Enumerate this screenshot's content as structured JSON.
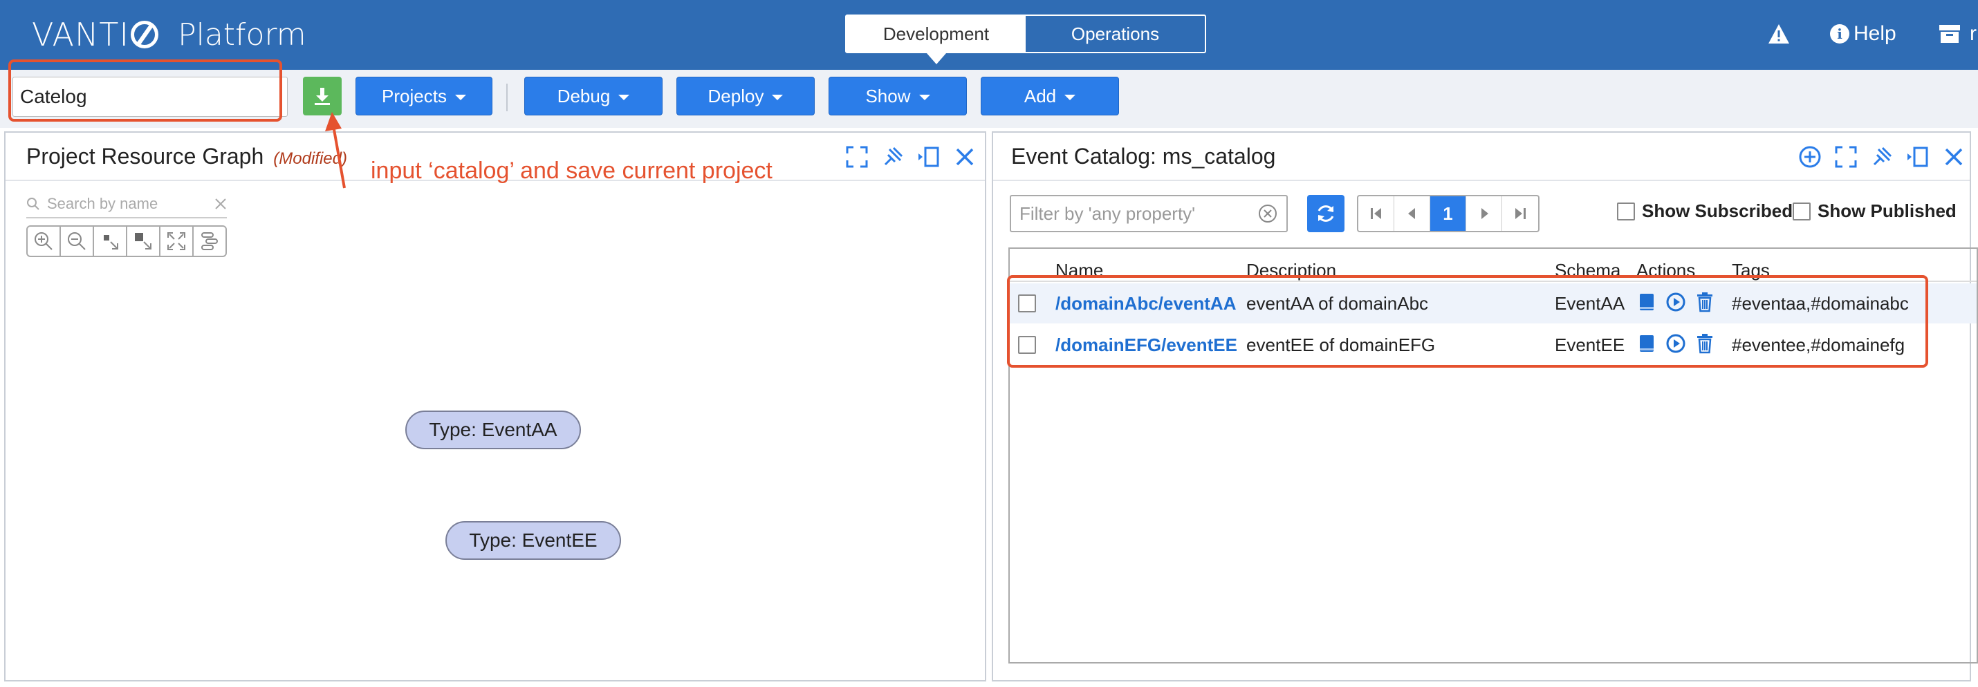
{
  "app": {
    "logo_text_left": "VANTI",
    "logo_text_right": "Platform",
    "modes": [
      "Development",
      "Operations"
    ],
    "active_mode": "Development",
    "help_label": "Help",
    "truncated_user": "r"
  },
  "toolbar": {
    "project_name": "Catelog",
    "buttons": [
      "Projects",
      "Debug",
      "Deploy",
      "Show",
      "Add"
    ]
  },
  "annotation": {
    "text": "input ‘catalog’ and save current project"
  },
  "graph_panel": {
    "title": "Project Resource Graph",
    "modified_label": "(Modified)",
    "search_placeholder": "Search by name",
    "nodes": [
      {
        "label": "Type: EventAA"
      },
      {
        "label": "Type: EventEE"
      }
    ]
  },
  "catalog_panel": {
    "title": "Event Catalog: ms_catalog",
    "filter_placeholder": "Filter by 'any property'",
    "current_page": "1",
    "show_subscribed": "Show Subscribed",
    "show_published": "Show Published",
    "columns": [
      "Name",
      "Description",
      "Schema",
      "Actions",
      "Tags"
    ],
    "rows": [
      {
        "name": "/domainAbc/eventAA",
        "description": "eventAA of domainAbc",
        "schema": "EventAA",
        "tags": "#eventaa,#domainabc"
      },
      {
        "name": "/domainEFG/eventEE",
        "description": "eventEE of domainEFG",
        "schema": "EventEE",
        "tags": "#eventee,#domainefg"
      }
    ]
  },
  "colors": {
    "header": "#2f6cb4",
    "primary_button": "#2b7de9",
    "save_button": "#5cb85c",
    "annotation": "#e5522f"
  }
}
